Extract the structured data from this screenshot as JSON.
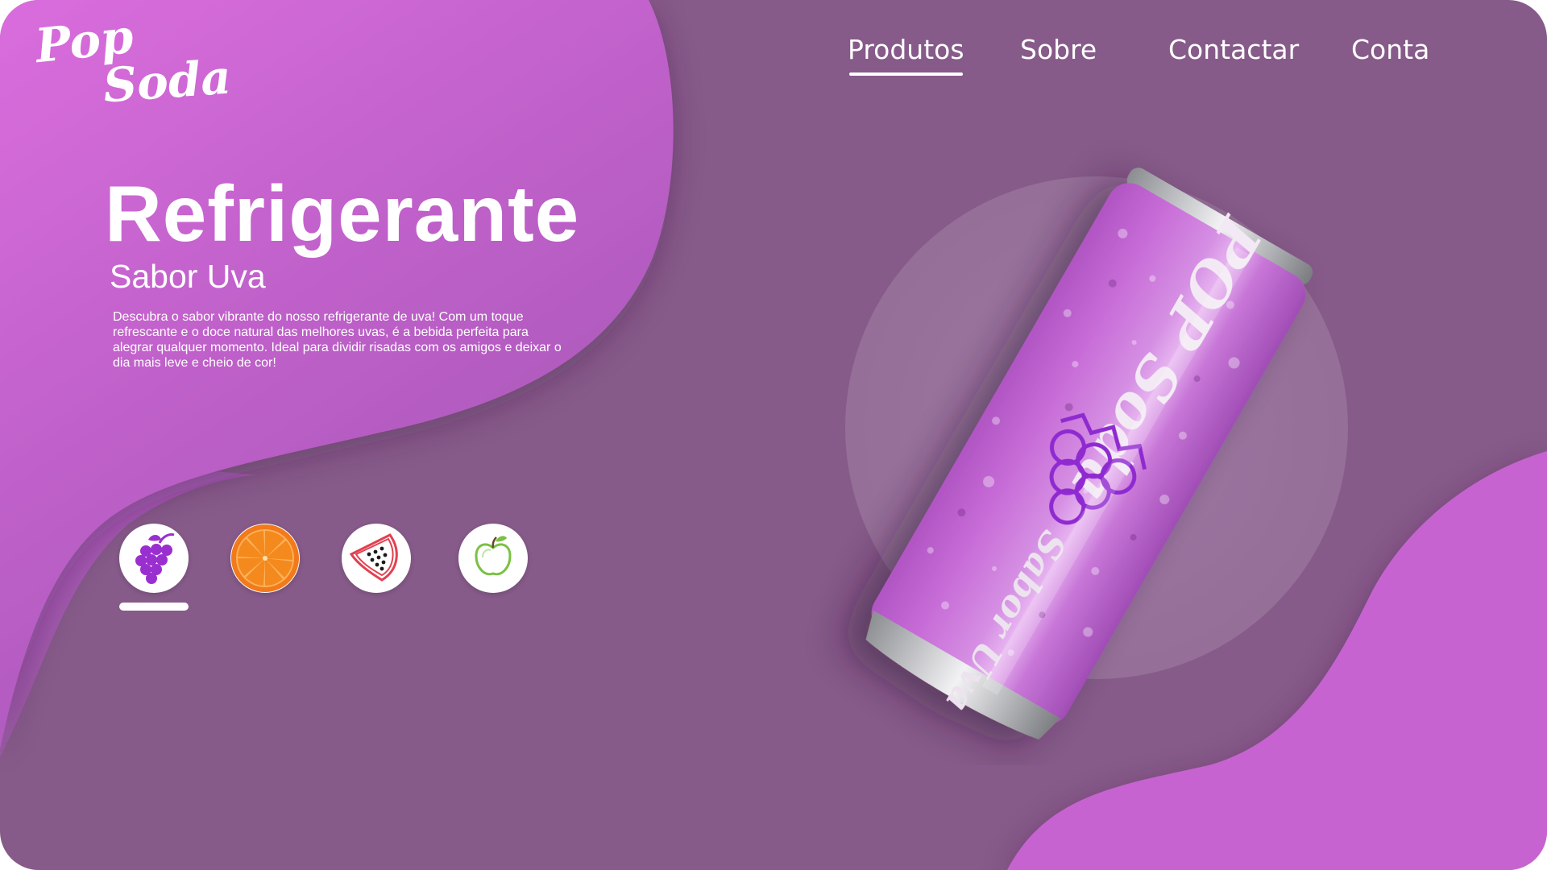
{
  "brand": {
    "line1": "Pop",
    "line2": "Soda"
  },
  "nav": {
    "items": [
      {
        "label": "Produtos",
        "active": true
      },
      {
        "label": "Sobre"
      },
      {
        "label": "Contactar"
      },
      {
        "label": "Conta"
      }
    ]
  },
  "hero": {
    "title": "Refrigerante",
    "subtitle": "Sabor Uva",
    "description": "Descubra o sabor vibrante do nosso refrigerante de uva! Com um toque refrescante e o doce natural das melhores uvas, é a bebida perfeita para alegrar qualquer momento. Ideal para dividir risadas com os amigos e deixar o dia mais leve e cheio de cor!"
  },
  "flavors": [
    {
      "name": "grape",
      "icon": "grape-icon",
      "selected": true
    },
    {
      "name": "orange",
      "icon": "orange-slice-icon"
    },
    {
      "name": "watermelon",
      "icon": "watermelon-icon"
    },
    {
      "name": "apple",
      "icon": "apple-icon"
    }
  ],
  "can": {
    "brand": "POP Soda",
    "flavor_label": "Sabor Uva"
  },
  "colors": {
    "background": "#865a89",
    "accent_pink": "#d36cdb",
    "can_body": "#c36ad1",
    "grape_purple": "#9a2fd0"
  }
}
